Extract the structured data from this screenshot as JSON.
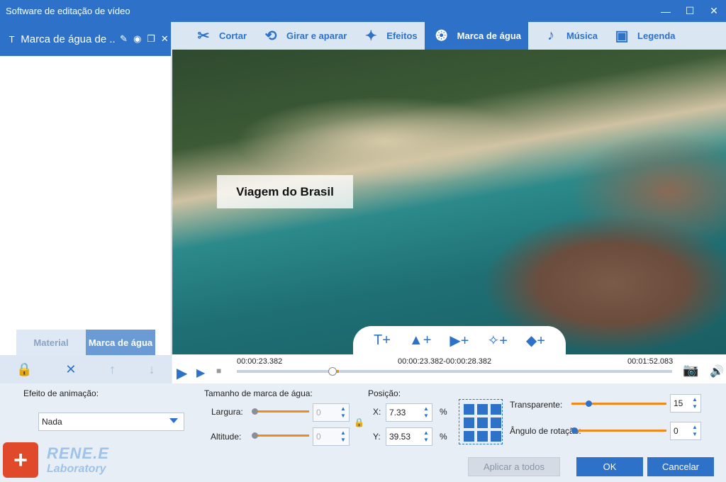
{
  "window": {
    "title": "Software de editação de vídeo",
    "minimize": "—",
    "maximize": "☐",
    "close": "✕"
  },
  "left_panel": {
    "item_title": "Marca de água de ...",
    "tabs": [
      {
        "label": "Material"
      },
      {
        "label": "Marca de água"
      }
    ],
    "tools": [
      "lock-icon",
      "delete-icon",
      "move-up-icon",
      "move-down-icon"
    ]
  },
  "toolbar": {
    "items": [
      {
        "label": "Cortar",
        "icon": "scissors-icon"
      },
      {
        "label": "Girar e aparar",
        "icon": "rotate-crop-icon"
      },
      {
        "label": "Efeitos",
        "icon": "effects-icon"
      },
      {
        "label": "Marca de água",
        "icon": "watermark-icon",
        "active": true
      },
      {
        "label": "Música",
        "icon": "music-icon"
      },
      {
        "label": "Legenda",
        "icon": "subtitle-icon"
      }
    ]
  },
  "video": {
    "watermark_text": "Viagem do Brasil",
    "tools": [
      "add-text-icon",
      "add-image-icon",
      "add-video-icon",
      "add-shape-icon",
      "add-eraser-icon"
    ]
  },
  "timeline": {
    "current_time": "00:00:23.382",
    "range": "00:00:23.382-00:00:28.382",
    "total_time": "00:01:52.083",
    "progress": 0.21
  },
  "settings": {
    "animation_label": "Efeito de animação:",
    "animation_value": "Nada",
    "size_label": "Tamanho de marca de água:",
    "width_label": "Largura:",
    "width_value": "0",
    "height_label": "Altitude:",
    "height_value": "0",
    "position_label": "Posição:",
    "x_label": "X:",
    "x_value": "7.33",
    "y_label": "Y:",
    "y_value": "39.53",
    "percent": "%",
    "transparency_label": "Transparente:",
    "transparency_value": "15",
    "rotation_label": "Ângulo de rotação:",
    "rotation_value": "0"
  },
  "buttons": {
    "apply_all": "Aplicar a todos",
    "ok": "OK",
    "cancel": "Cancelar"
  },
  "logo": {
    "name": "RENE.E",
    "sub": "Laboratory"
  },
  "colors": {
    "accent": "#2d72c8",
    "slider": "#f08a1c"
  }
}
